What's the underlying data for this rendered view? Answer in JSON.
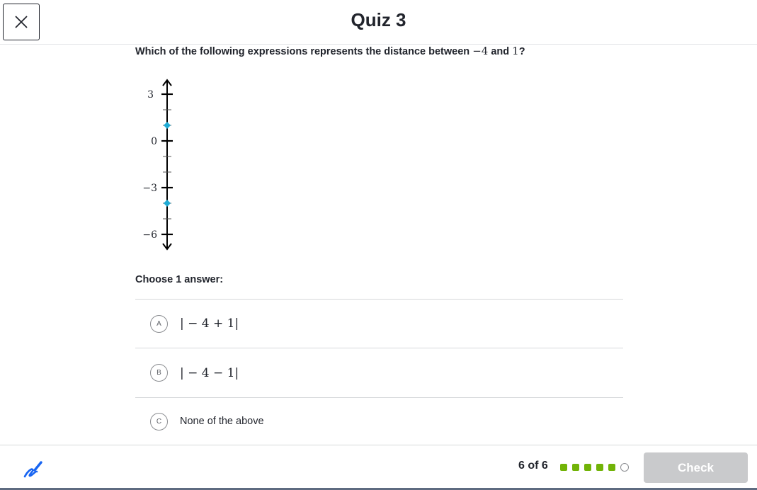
{
  "header": {
    "title": "Quiz 3",
    "close_icon": "close-icon"
  },
  "question": {
    "prefix": "Which of the following expressions represents the distance between ",
    "value_a": "−4",
    "middle": " and ",
    "value_b": "1",
    "suffix": "?"
  },
  "number_line": {
    "orientation": "vertical",
    "range": [
      -6,
      3
    ],
    "labeled_ticks": [
      "3",
      "0",
      "−3",
      "−6"
    ],
    "points": [
      1,
      -4
    ],
    "point_color": "#1fabd5"
  },
  "choose_label": "Choose 1 answer:",
  "choices": [
    {
      "letter": "A",
      "text": "| − 4 + 1|"
    },
    {
      "letter": "B",
      "text": "| − 4 − 1|"
    },
    {
      "letter": "C",
      "text": "None of the above"
    }
  ],
  "footer": {
    "scratchpad_icon": "scratchpad-pencil-icon",
    "progress_text": "6 of 6",
    "progress_total": 6,
    "progress_completed": 5,
    "check_label": "Check",
    "accent_color": "#71b307"
  }
}
